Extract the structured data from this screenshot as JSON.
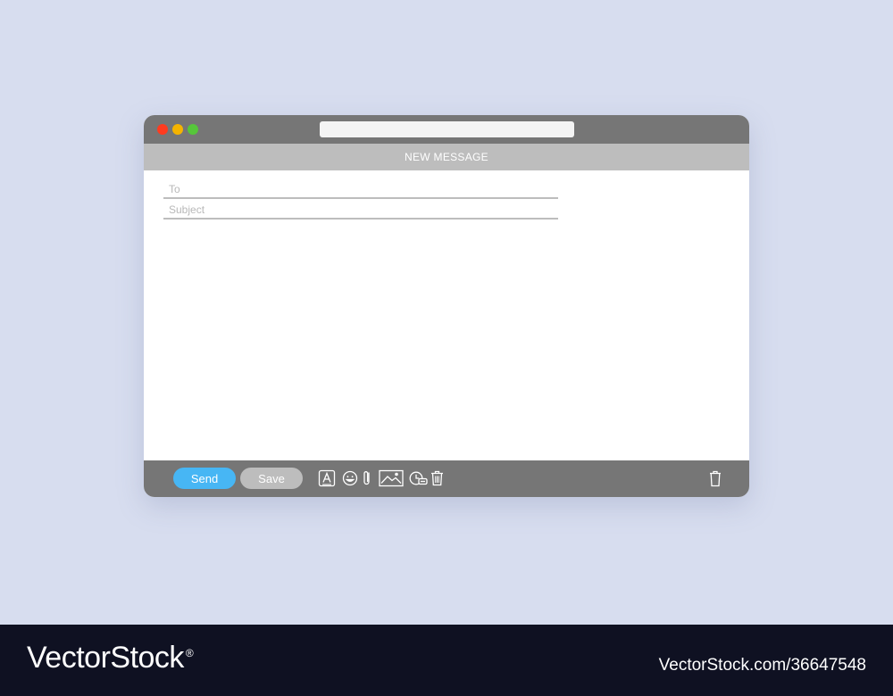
{
  "window": {
    "header_title": "NEW MESSAGE",
    "address_bar_value": ""
  },
  "compose": {
    "to_placeholder": "To",
    "subject_placeholder": "Subject",
    "body_value": ""
  },
  "toolbar": {
    "send_label": "Send",
    "save_label": "Save",
    "icons": [
      "format-text-icon",
      "emoji-icon",
      "attachment-icon",
      "image-icon",
      "schedule-icon",
      "delete-icon"
    ],
    "discard_icon": "trash-icon"
  },
  "footer": {
    "brand": "VectorStock",
    "registered_mark": "®",
    "stock_id": "VectorStock.com/36647548"
  },
  "colors": {
    "page_background": "#d7ddef",
    "chrome": "#767676",
    "subbar": "#bdbdbd",
    "send_button": "#47b6f4",
    "save_button": "#bdbdbd",
    "close_dot": "#ff3b1f",
    "minimize_dot": "#f5b400",
    "maximize_dot": "#56c63a",
    "footer_background": "#0f1122"
  }
}
